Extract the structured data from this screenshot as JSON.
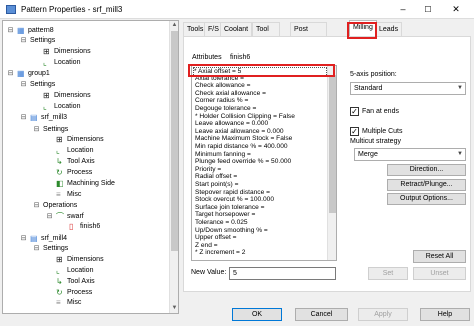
{
  "window": {
    "title": "Pattern Properties - srf_mill3",
    "minimize": "–",
    "maximize": "☐",
    "close": "✕"
  },
  "tree": [
    {
      "label": "pattern8",
      "expander": "⊟",
      "icon": "pattern-icon",
      "color": "#3a7bd5"
    },
    {
      "label": "Settings",
      "expander": "⊟",
      "icon": "none"
    },
    {
      "label": "Dimensions",
      "icon": "dimensions-icon",
      "color": "#222"
    },
    {
      "label": "Location",
      "icon": "location-icon",
      "color": "#2d8a2d"
    },
    {
      "label": "group1",
      "expander": "⊟",
      "icon": "group-icon",
      "color": "#3a7bd5"
    },
    {
      "label": "Settings",
      "expander": "⊟",
      "icon": "none"
    },
    {
      "label": "Dimensions",
      "icon": "dimensions-icon",
      "color": "#222"
    },
    {
      "label": "Location",
      "icon": "location-icon",
      "color": "#2d8a2d"
    },
    {
      "label": "srf_mill3",
      "expander": "⊟",
      "icon": "mill-icon",
      "color": "#3a7bd5"
    },
    {
      "label": "Settings",
      "expander": "⊟",
      "icon": "none"
    },
    {
      "label": "Dimensions",
      "icon": "dimensions-icon",
      "color": "#222"
    },
    {
      "label": "Location",
      "icon": "location-icon",
      "color": "#2d8a2d"
    },
    {
      "label": "Tool Axis",
      "icon": "tool-axis-icon",
      "color": "#2d8a2d"
    },
    {
      "label": "Process",
      "icon": "process-icon",
      "color": "#2d8a2d"
    },
    {
      "label": "Machining Side",
      "icon": "side-icon",
      "color": "#2d8a2d"
    },
    {
      "label": "Misc",
      "icon": "misc-icon",
      "color": "#888"
    },
    {
      "label": "Operations",
      "expander": "⊟",
      "icon": "none"
    },
    {
      "label": "swarf",
      "expander": "⊟",
      "icon": "swarf-icon",
      "color": "#2d8a2d"
    },
    {
      "label": "finish6",
      "icon": "finish-icon",
      "color": "#d93030"
    },
    {
      "label": "srf_mill4",
      "expander": "⊟",
      "icon": "mill-icon",
      "color": "#3a7bd5"
    },
    {
      "label": "Settings",
      "expander": "⊟",
      "icon": "none"
    },
    {
      "label": "Dimensions",
      "icon": "dimensions-icon",
      "color": "#222"
    },
    {
      "label": "Location",
      "icon": "location-icon",
      "color": "#2d8a2d"
    },
    {
      "label": "Tool Axis",
      "icon": "tool-axis-icon",
      "color": "#2d8a2d"
    },
    {
      "label": "Process",
      "icon": "process-icon",
      "color": "#2d8a2d"
    },
    {
      "label": "Misc",
      "icon": "misc-icon",
      "color": "#888"
    }
  ],
  "tabs": [
    "Tools",
    "F/S",
    "Coolant",
    "Tool Usage",
    "Post Variables",
    "Milling",
    "Leads"
  ],
  "active_tab": "Milling",
  "attributes": {
    "label": "Attributes",
    "value": "finish6"
  },
  "attribute_list": [
    "* Axial offset = 5",
    "Axial tolerance =",
    "Check allowance =",
    "Check axial allowance =",
    "Corner radius % =",
    "Degouge tolerance =",
    "* Holder Collision Clipping = False",
    "Leave allowance = 0.000",
    "Leave axial allowance = 0.000",
    "Machine Maximum Stock = False",
    "Min rapid distance % = 400.000",
    "Minimum fanning =",
    "Plunge feed override % = 50.000",
    "Priority =",
    "Radial offset =",
    "Start point(s) =",
    "Stepover rapid distance =",
    "Stock overcut % = 100.000",
    "Surface join tolerance =",
    "Target horsepower =",
    "Tolerance = 0.025",
    "Up/Down smoothing % =",
    "Upper offset =",
    "Z end =",
    "* Z increment = 2"
  ],
  "new_value": {
    "label": "New Value:",
    "value": "5"
  },
  "five_axis": {
    "label": "5-axis position:",
    "value": "Standard"
  },
  "fan_at_ends": {
    "label": "Fan at ends",
    "checked": true,
    "mark": "✓"
  },
  "multiple_cuts": {
    "label": "Multiple Cuts",
    "checked": true,
    "mark": "✓"
  },
  "multicut": {
    "label": "Multicut strategy",
    "value": "Merge"
  },
  "buttons": {
    "direction": "Direction...",
    "retract": "Retract/Plunge...",
    "output": "Output Options...",
    "reset_all": "Reset All",
    "set": "Set",
    "unset": "Unset",
    "ok": "OK",
    "cancel": "Cancel",
    "apply": "Apply",
    "help": "Help"
  },
  "highlight_color": "#e02020"
}
